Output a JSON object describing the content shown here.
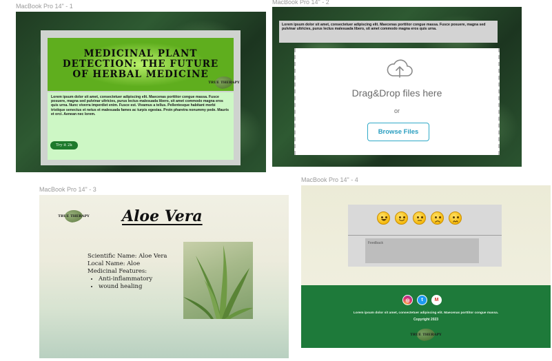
{
  "frames": {
    "f1": {
      "label": "MacBook Pro 14\" - 1"
    },
    "f2": {
      "label": "MacBook Pro 14\" - 2"
    },
    "f3": {
      "label": "MacBook Pro 14\" - 3"
    },
    "f4": {
      "label": "MacBook Pro 14\" - 4"
    }
  },
  "home": {
    "title": "MEDICINAL PLANT DETECTION: THE FUTURE OF HERBAL MEDICINE",
    "body": "Lorem ipsum dolor sit amet, consectetuer adipiscing elit. Maecenas porttitor congue massa. Fusce posuere, magna sed pulvinar ultricies, purus lectus malesuada libero, sit amet commodo magna eros quis urna. Nunc viverra imperdiet enim. Fusce est. Vivamus a tellus. Pellentesque habitant morbi tristique senectus et netus et malesuada fames ac turpis egestas. Proin pharetra nonummy pede. Mauris et orci. Aenean nec lorem.",
    "button": "Try it 2k",
    "logo": "TRUE THERAPY"
  },
  "upload": {
    "text": "Lorem ipsum dolor sit amet, consectetuer adipiscing elit. Maecenas porttitor congue massa. Fusce posuere, magna sed pulvinar ultricies, purus lectus malesuada libero, sit amet commodo magna eros quis urna.",
    "drag": "Drag&Drop files here",
    "or": "or",
    "browse": "Browse Files"
  },
  "plant": {
    "title": "Aloe Vera",
    "scientific": "Scientific Name: Aloe Vera",
    "local": "Local Name: Aloe",
    "features_label": "Medicinal Features:",
    "features": [
      "Anti-inflammatory",
      "wound healing"
    ],
    "logo": "TRUE THERAPY"
  },
  "feedback": {
    "placeholder": "Feedback",
    "footer_text": "Lorem ipsum dolor sit amet, consectetuer adipiscing elit. Maecenas porttitor congue massa.",
    "copyright": "Copyright 2023",
    "logo": "TRUE THERAPY",
    "emojis": [
      "very-happy",
      "happy",
      "neutral",
      "sad",
      "angry"
    ]
  }
}
